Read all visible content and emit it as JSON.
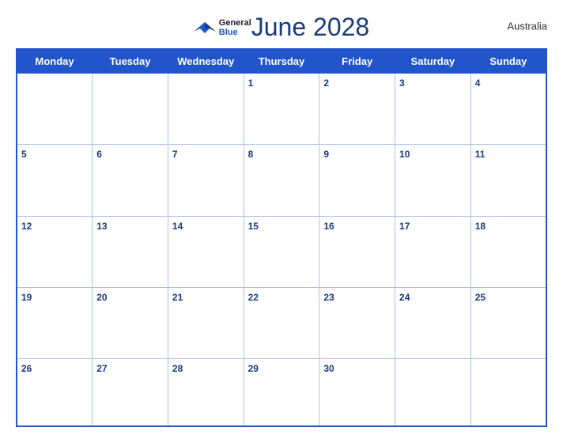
{
  "header": {
    "title": "June 2028",
    "country": "Australia",
    "logo": {
      "general": "General",
      "blue": "Blue"
    }
  },
  "weekdays": [
    "Monday",
    "Tuesday",
    "Wednesday",
    "Thursday",
    "Friday",
    "Saturday",
    "Sunday"
  ],
  "weeks": [
    [
      null,
      null,
      null,
      1,
      2,
      3,
      4
    ],
    [
      5,
      6,
      7,
      8,
      9,
      10,
      11
    ],
    [
      12,
      13,
      14,
      15,
      16,
      17,
      18
    ],
    [
      19,
      20,
      21,
      22,
      23,
      24,
      25
    ],
    [
      26,
      27,
      28,
      29,
      30,
      null,
      null
    ]
  ]
}
